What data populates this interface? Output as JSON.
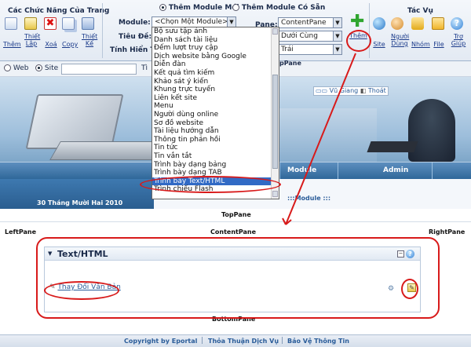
{
  "control_panel": {
    "group_title": "Các Chức Năng Của Trang",
    "page_actions": [
      {
        "label": "Thêm",
        "icon": "add-page-icon"
      },
      {
        "label": "Thiết\nLập",
        "icon": "settings-page-icon"
      },
      {
        "label": "Xoá",
        "icon": "delete-page-icon"
      },
      {
        "label": "Copy",
        "icon": "copy-page-icon"
      },
      {
        "label": "Thiết\nKế",
        "icon": "design-page-icon"
      }
    ],
    "radio_new_module": "Thêm Module Mới",
    "radio_existing_module": "Thêm Module Có Sẵn",
    "module_label": "Module:",
    "module_selected": "<Chọn Một Module>",
    "title_label": "Tiêu Đề:",
    "view_label": "Tính Hiển Thị:",
    "pane_label": "Pane:",
    "pane_selected": "ContentPane",
    "position_selected": "Dưới Cùng",
    "align_selected": "Trái",
    "add_label": "Thêm",
    "tasks_title": "Tác Vụ",
    "tasks": [
      {
        "label": "Site",
        "icon": "site-icon"
      },
      {
        "label": "Người\nDùng",
        "icon": "users-icon"
      },
      {
        "label": "Nhóm",
        "icon": "roles-icon"
      },
      {
        "label": "File",
        "icon": "file-icon"
      },
      {
        "label": "Trợ\nGiúp",
        "icon": "help-icon"
      }
    ]
  },
  "module_dropdown": {
    "items": [
      "Bộ sưu tập ảnh",
      "Danh sách tài liệu",
      "Đếm lượt truy cập",
      "Dịch website bằng Google",
      "Diễn đàn",
      "Kết quả tìm kiếm",
      "Khảo sát ý kiến",
      "Khung trực tuyến",
      "Liên kết site",
      "Menu",
      "Người dùng online",
      "Sơ đồ website",
      "Tài liệu hướng dẫn",
      "Thông tin phản hồi",
      "Tin tức",
      "Tin vắn tắt",
      "Trình bày dạng bảng",
      "Trình bày dạng TAB",
      "Trình bày Text/HTML",
      "Trình chiếu Flash"
    ],
    "selected_index": 18
  },
  "search_bar": {
    "radio_web": "Web",
    "radio_site": "Site",
    "partial_text": "Tì",
    "pane_hint": "pPane"
  },
  "banner": {
    "links": [
      "Vũ Giang",
      "Thoát"
    ]
  },
  "menu": {
    "items": [
      "Module",
      "Admin"
    ]
  },
  "date_text": "30 Tháng Mười Hai 2010",
  "breadcrumb": ":::Module :::",
  "panes": {
    "top": "TopPane",
    "left": "LeftPane",
    "content": "ContentPane",
    "right": "RightPane",
    "bottom": "BottomPane"
  },
  "module_box": {
    "title": "Text/HTML",
    "edit_link": "Thay Đổi Văn Bản"
  },
  "footer": {
    "copyright": "Copyright by Eportal",
    "terms": "Thỏa Thuận Dịch Vụ",
    "privacy": "Bảo Vệ Thông Tin"
  },
  "colors": {
    "accent_red": "#d81a1a",
    "header_blue": "#2f6799",
    "link_blue": "#1a3a8a",
    "dropdown_highlight": "#316ac5"
  }
}
